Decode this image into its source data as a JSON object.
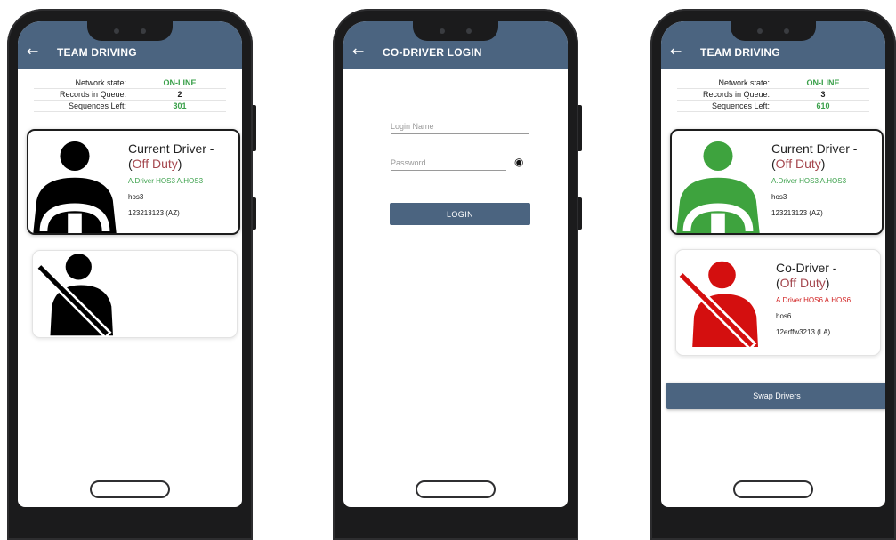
{
  "screens": [
    {
      "title": "TEAM DRIVING",
      "stats": [
        {
          "label": "Network state:",
          "value": "ON-LINE"
        },
        {
          "label": "Records in Queue:",
          "value": "2"
        },
        {
          "label": "Sequences Left:",
          "value": "301"
        }
      ],
      "driver": {
        "role": "Current Driver -",
        "duty_open": "(",
        "duty": "Off Duty",
        "duty_close": ")",
        "names": "A.Driver HOS3 A.HOS3",
        "username": "hos3",
        "license": "123213123 (AZ)"
      }
    },
    {
      "title": "CO-DRIVER LOGIN",
      "login_placeholder": "Login Name",
      "password_placeholder": "Password",
      "login_button": "LOGIN"
    },
    {
      "title": "TEAM DRIVING",
      "stats": [
        {
          "label": "Network state:",
          "value": "ON-LINE"
        },
        {
          "label": "Records in Queue:",
          "value": "3"
        },
        {
          "label": "Sequences Left:",
          "value": "610"
        }
      ],
      "driver": {
        "role": "Current Driver -",
        "duty_open": "(",
        "duty": "Off Duty",
        "duty_close": ")",
        "names": "A.Driver HOS3 A.HOS3",
        "username": "hos3",
        "license": "123213123 (AZ)"
      },
      "codriver": {
        "role": "Co-Driver -",
        "duty_open": "(",
        "duty": "Off Duty",
        "duty_close": ")",
        "names": "A.Driver HOS6 A.HOS6",
        "username": "hos6",
        "license": "12erffw3213 (LA)"
      },
      "swap_button": "Swap Drivers"
    }
  ],
  "icons": {
    "back": "arrow-left-icon",
    "driver": "driver-steering-wheel-icon",
    "codriver": "seatbelt-passenger-icon",
    "eye": "eye-icon"
  },
  "colors": {
    "appbar": "#4b6480",
    "online": "#3aa04a",
    "off_duty": "#a5484f",
    "current_driver_active": "#3ea33e",
    "codriver_active": "#d40f0f",
    "codriver_names": "#d12121"
  }
}
